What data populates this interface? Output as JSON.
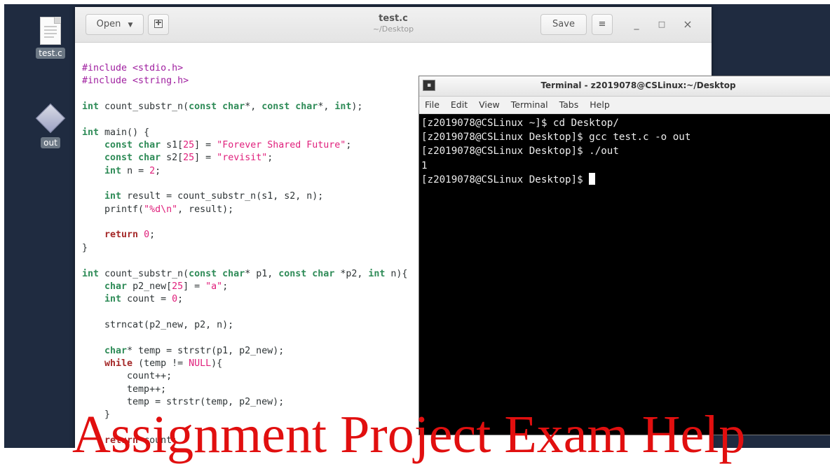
{
  "desktop": {
    "icons": [
      {
        "label": "test.c",
        "icon": "text-file-icon"
      },
      {
        "label": "out",
        "icon": "executable-icon"
      }
    ]
  },
  "editor": {
    "open_label": "Open",
    "title": "test.c",
    "subtitle": "~/Desktop",
    "save_label": "Save",
    "menu_glyph": "≡",
    "minimize_glyph": "_",
    "maximize_glyph": "□",
    "close_glyph": "×",
    "code_lines": [
      "#include <stdio.h>",
      "#include <string.h>",
      "",
      "int count_substr_n(const char*, const char*, int);",
      "",
      "int main() {",
      "    const char s1[25] = \"Forever Shared Future\";",
      "    const char s2[25] = \"revisit\";",
      "    int n = 2;",
      "",
      "    int result = count_substr_n(s1, s2, n);",
      "    printf(\"%d\\n\", result);",
      "",
      "    return 0;",
      "}",
      "",
      "int count_substr_n(const char* p1, const char *p2, int n){",
      "    char p2_new[25] = \"a\";",
      "    int count = 0;",
      "",
      "    strncat(p2_new, p2, n);",
      "",
      "    char* temp = strstr(p1, p2_new);",
      "    while (temp != NULL){",
      "        count++;",
      "        temp++;",
      "        temp = strstr(temp, p2_new);",
      "    }",
      "",
      "    return count;",
      "}"
    ]
  },
  "terminal": {
    "title": "Terminal - z2019078@CSLinux:~/Desktop",
    "menu": [
      "File",
      "Edit",
      "View",
      "Terminal",
      "Tabs",
      "Help"
    ],
    "lines": [
      "[z2019078@CSLinux ~]$ cd Desktop/",
      "[z2019078@CSLinux Desktop]$ gcc test.c -o out",
      "[z2019078@CSLinux Desktop]$ ./out",
      "1",
      "[z2019078@CSLinux Desktop]$ "
    ]
  },
  "watermark": "Assignment Project Exam Help",
  "colors": {
    "desktop_bg": "#1f2b40",
    "keyword": "#a52a2a",
    "type": "#2e8b57",
    "preprocessor": "#a020a0",
    "literal": "#e0207c",
    "watermark": "#e10f0f"
  }
}
